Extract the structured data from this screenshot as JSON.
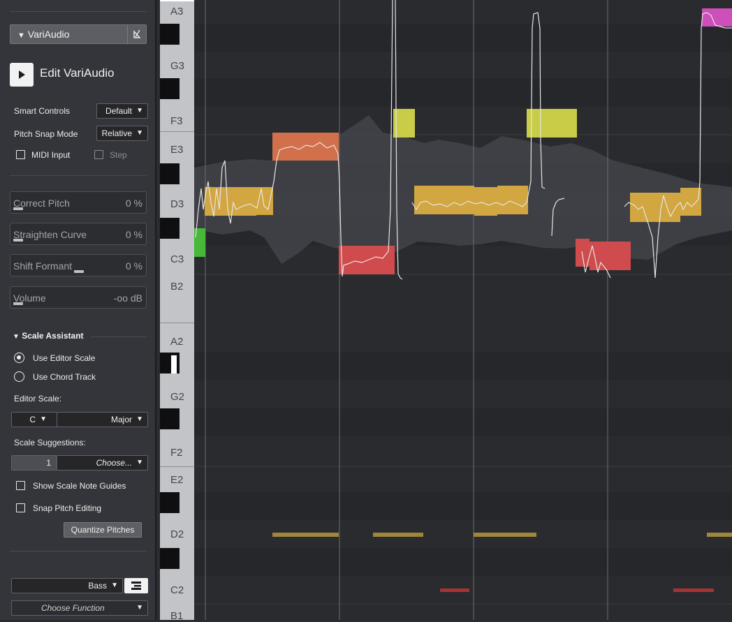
{
  "inspector": {
    "section_title": "VariAudio",
    "edit_label": "Edit VariAudio",
    "smart_controls": {
      "label": "Smart Controls",
      "value": "Default"
    },
    "pitch_snap_mode": {
      "label": "Pitch Snap Mode",
      "value": "Relative"
    },
    "midi_input_label": "MIDI Input",
    "step_label": "Step",
    "sliders": [
      {
        "name": "Correct Pitch",
        "value": "0 %"
      },
      {
        "name": "Straighten Curve",
        "value": "0 %"
      },
      {
        "name": "Shift Formant",
        "value": "0 %"
      },
      {
        "name": "Volume",
        "value": "-oo dB"
      }
    ],
    "scale_assistant": {
      "title": "Scale Assistant",
      "use_editor_scale": "Use Editor Scale",
      "use_chord_track": "Use Chord Track",
      "editor_scale_label": "Editor Scale:",
      "root": "C",
      "mode": "Major",
      "suggestions_label": "Scale Suggestions:",
      "suggestion_index": "1",
      "suggestion_choose": "Choose...",
      "show_scale_note_guides": "Show Scale Note Guides",
      "snap_pitch_editing": "Snap Pitch Editing",
      "quantize_pitches": "Quantize Pitches"
    },
    "bottom": {
      "bass_label": "Bass",
      "choose_function": "Choose Function"
    }
  },
  "keyboard": {
    "labels": [
      "A3",
      "G3",
      "F3",
      "E3",
      "D3",
      "C3",
      "B2",
      "A2",
      "G2",
      "F2",
      "E2",
      "D2",
      "C2",
      "B1"
    ]
  },
  "colors": {
    "segment_yellow": "#d2a640",
    "segment_orange": "#d2704b",
    "segment_red": "#cf4b4d",
    "segment_lime": "#c9cc46",
    "segment_green": "#48b839",
    "segment_magenta": "#cc4fba",
    "midi_gold": "#a0853a",
    "midi_red": "#a63333"
  }
}
